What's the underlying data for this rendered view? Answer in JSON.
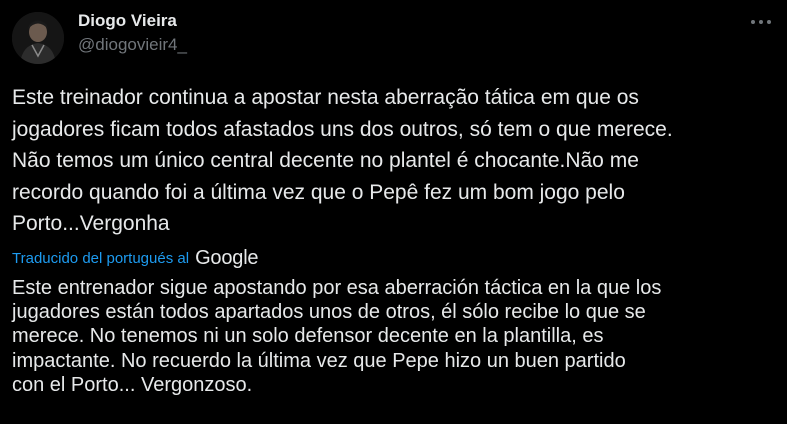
{
  "author": {
    "display_name": "Diogo Vieira",
    "handle": "@diogovieir4_",
    "avatar_icon": "user-avatar"
  },
  "tweet": {
    "text": "Este treinador continua a apostar nesta aberração tática em que os\njogadores ficam todos afastados uns dos outros, só tem o que merece.\nNão temos um único central decente no plantel é chocante.Não me\nrecordo quando foi a última vez que o Pepê fez um bom jogo pelo\nPorto...Vergonha"
  },
  "translation": {
    "label": "Traducido del portugués al",
    "provider": "Google",
    "text": "Este entrenador sigue apostando por esa aberración táctica en la que los\njugadores están todos apartados unos de otros, él sólo recibe lo que se\nmerece. No tenemos ni un solo defensor decente en la plantilla, es\nimpactante. No recuerdo la última vez que Pepe hizo un buen partido\ncon el Porto... Vergonzoso."
  },
  "more_icon": "more-horizontal-icon",
  "colors": {
    "background": "#000000",
    "text": "#e7e9ea",
    "muted": "#71767b",
    "link": "#1d9bf0"
  }
}
